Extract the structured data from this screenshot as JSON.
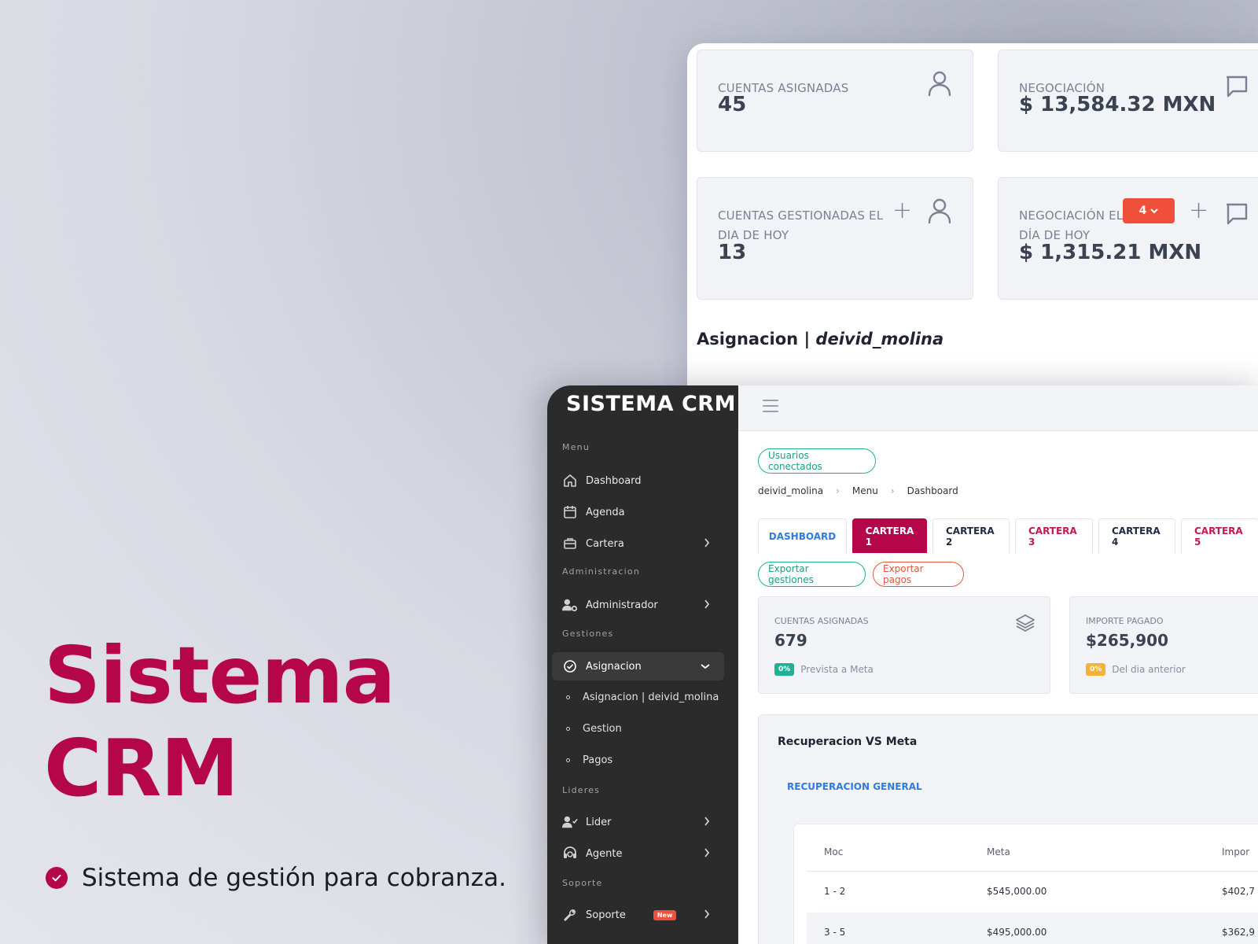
{
  "hero": {
    "title_line1": "Sistema",
    "title_line2": "CRM",
    "feature": "Sistema de gestión para cobranza.",
    "brand_color": "#b5064a"
  },
  "back_dashboard": {
    "kpis": [
      {
        "label": "CUENTAS ASIGNADAS",
        "value": "45",
        "icon": "user-icon"
      },
      {
        "label": "NEGOCIACIÓN",
        "value": "$ 13,584.32 MXN",
        "icon": "chat-icon"
      },
      {
        "label_line1": "CUENTAS GESTIONADAS EL",
        "label_line2": "DIA DE HOY",
        "value": "13",
        "icon": "user-icon",
        "action": "+"
      },
      {
        "label_line1": "NEGOCIACIÓN EL",
        "label_line2": "DÍA DE HOY",
        "value": "$ 1,315.21 MXN",
        "icon": "chat-icon",
        "action": "+",
        "badge": "4"
      }
    ],
    "section_title_prefix": "Asignacion | ",
    "section_title_user": "deivid_molina"
  },
  "sidebar": {
    "brand": "SISTEMA CRM",
    "sections": {
      "menu": "Menu",
      "administracion": "Administracion",
      "gestiones": "Gestiones",
      "lideres": "Lideres",
      "soporte": "Soporte"
    },
    "items": {
      "dashboard": "Dashboard",
      "agenda": "Agenda",
      "cartera": "Cartera",
      "administrador": "Administrador",
      "asignacion": "Asignacion",
      "lider": "Lider",
      "agente": "Agente",
      "soporte": "Soporte",
      "soporte_badge": "New"
    },
    "subitems": [
      "Asignacion | deivid_molina",
      "Gestion",
      "Pagos"
    ]
  },
  "main": {
    "connected_users": "Usuarios conectados",
    "breadcrumb": [
      "deivid_molina",
      "Menu",
      "Dashboard"
    ],
    "tabs": [
      "DASHBOARD",
      "CARTERA 1",
      "CARTERA 2",
      "CARTERA 3",
      "CARTERA 4",
      "CARTERA 5"
    ],
    "active_tab": "CARTERA 1",
    "export_gestiones": "Exportar gestiones",
    "export_pagos": "Exportar pagos",
    "cards": [
      {
        "label": "CUENTAS ASIGNADAS",
        "value": "679",
        "badge": "0%",
        "foot": "Prevista a Meta",
        "badge_color": "#1bb394",
        "icon": "layers-icon"
      },
      {
        "label": "IMPORTE PAGADO",
        "value": "$265,900",
        "badge": "0%",
        "foot": "Del dia anterior",
        "badge_color": "#f2b336"
      }
    ],
    "panel": {
      "title": "Recuperacion VS Meta",
      "tab": "RECUPERACION GENERAL",
      "columns": [
        "Moc",
        "Meta",
        "Impor"
      ],
      "rows": [
        [
          "1 - 2",
          "$545,000.00",
          "$402,7"
        ],
        [
          "3 - 5",
          "$495,000.00",
          "$362,9"
        ]
      ]
    }
  }
}
